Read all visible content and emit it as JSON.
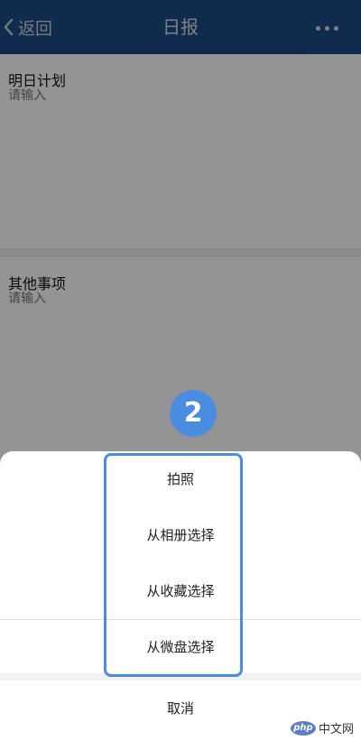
{
  "navbar": {
    "back_label": "返回",
    "title": "日报",
    "more_icon": "more-dots-icon",
    "back_icon": "chevron-left-icon",
    "color": "#1d4a86"
  },
  "form": {
    "plan": {
      "label": "明日计划",
      "placeholder": "请输入"
    },
    "other": {
      "label": "其他事项",
      "placeholder": "请输入"
    }
  },
  "step_badge": "2",
  "action_sheet": {
    "items": [
      "拍照",
      "从相册选择",
      "从收藏选择",
      "从微盘选择"
    ],
    "cancel_label": "取消"
  },
  "highlight_color": "#4a8de0",
  "watermark": {
    "php": "php",
    "site": "中文网"
  }
}
